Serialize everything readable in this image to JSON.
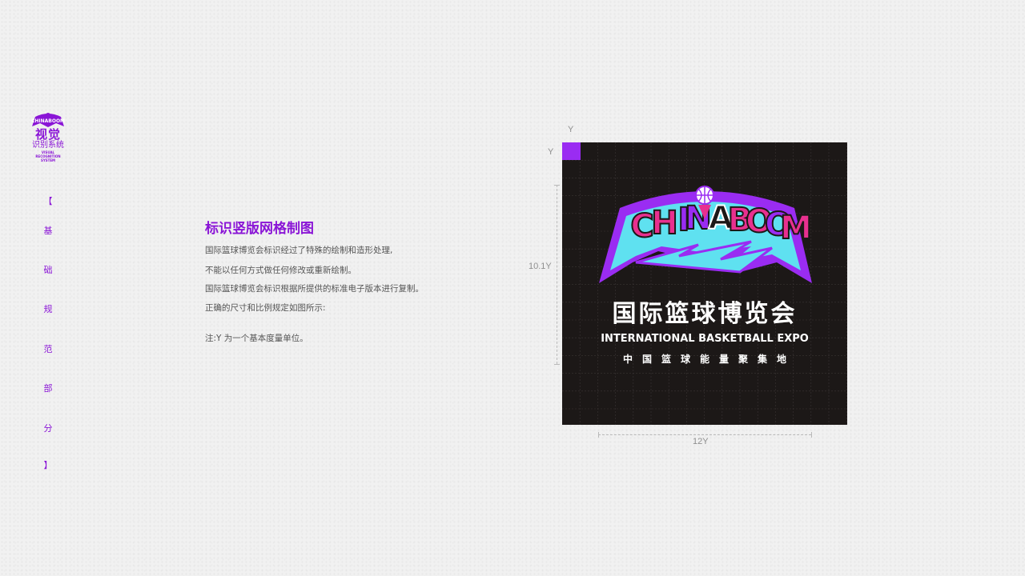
{
  "sidebar": {
    "logo_word": "CHINABOOM",
    "title": "视觉",
    "subtitle": "识别系统",
    "english": "VISUAL RECOGNITION SYSTEM",
    "nav": [
      "【",
      "基",
      "础",
      "规",
      "范",
      "部",
      "分",
      "】"
    ]
  },
  "content": {
    "title": "标识竖版网格制图",
    "lines": [
      "国际篮球博览会标识经过了特殊的绘制和造形处理,",
      "不能以任何方式做任何修改或重新绘制。",
      "国际篮球博览会标识根据所提供的标准电子版本进行复制。",
      "正确的尺寸和比例规定如图所示:"
    ],
    "note": "注:Y 为一个基本度量单位。"
  },
  "diagram": {
    "unit_top_label": "Y",
    "unit_left_label": "Y",
    "height_label": "10.1Y",
    "width_label": "12Y",
    "logo": {
      "word": "CHINABOOM",
      "chinese_name": "国际篮球博览会",
      "english_name": "INTERNATIONAL BASKETBALL EXPO",
      "slogan": "中国篮球能量聚集地"
    },
    "colors": {
      "purple": "#9a2cf2",
      "pink": "#e8308f",
      "cyan": "#5fe1f0",
      "board": "#1c1817"
    }
  }
}
